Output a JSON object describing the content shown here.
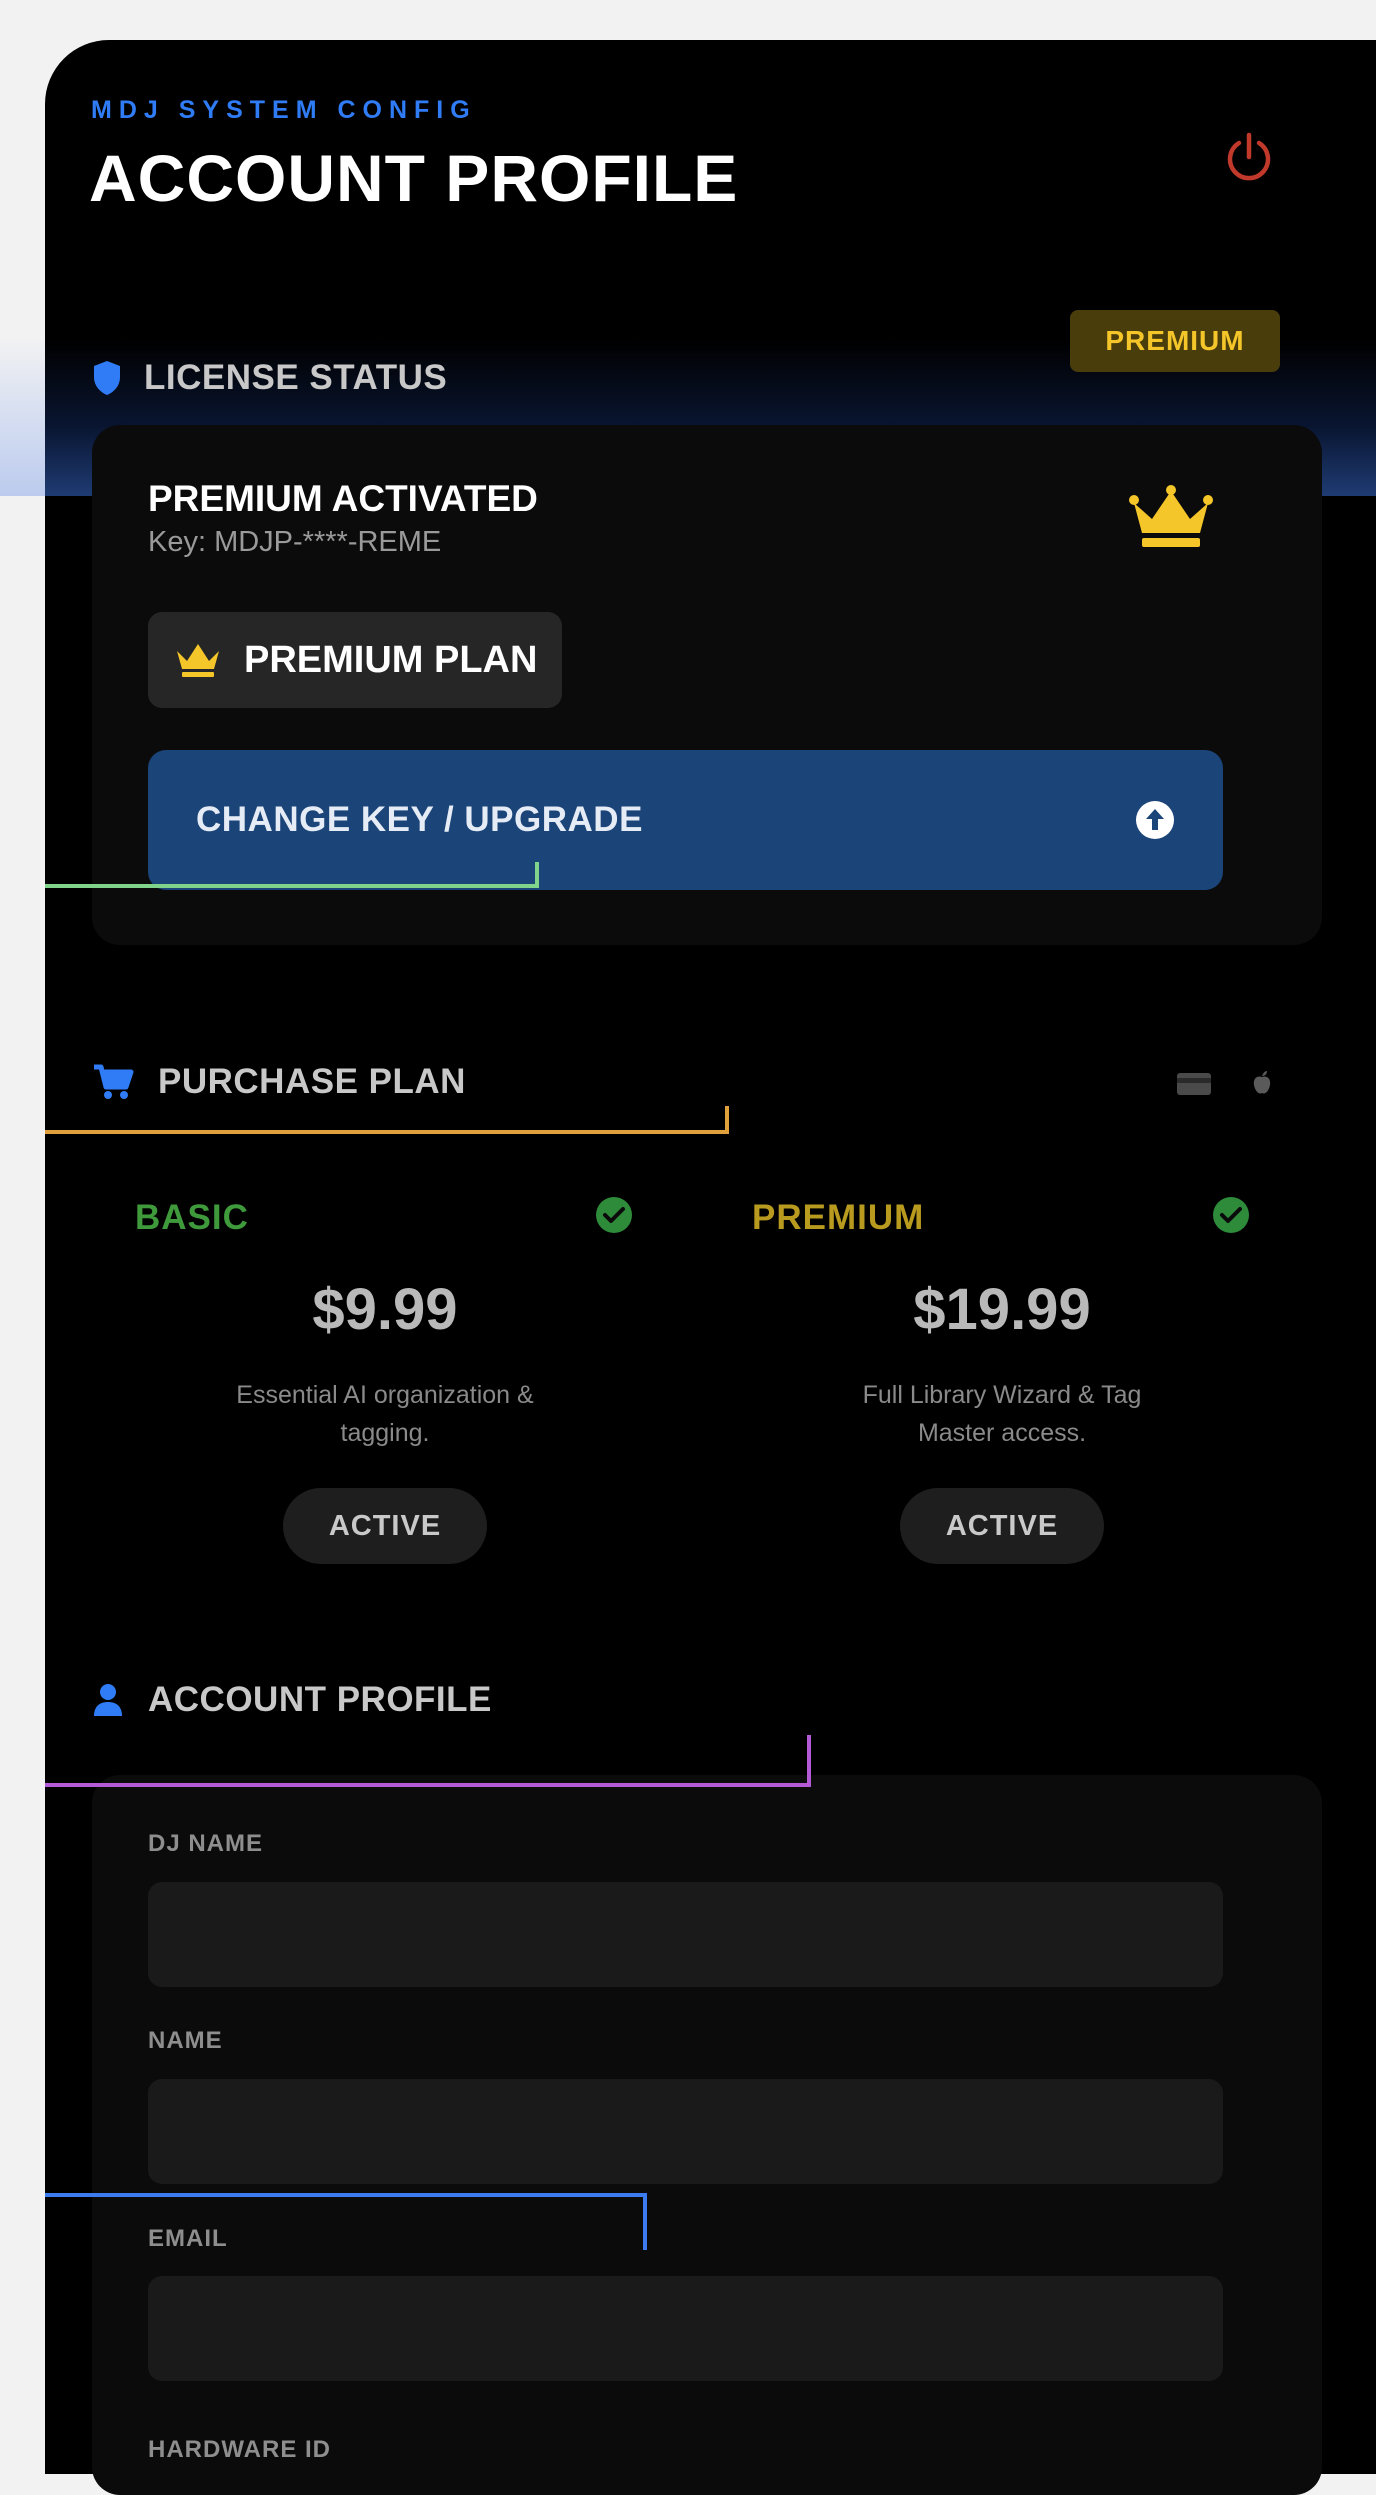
{
  "header": {
    "eyebrow": "MDJ SYSTEM CONFIG",
    "title": "ACCOUNT PROFILE",
    "power_icon": "power-icon"
  },
  "license": {
    "section_title": "LICENSE STATUS",
    "badge": "PREMIUM",
    "activated_title": "PREMIUM ACTIVATED",
    "key_text": "Key: MDJP-****-REME",
    "plan_chip": "PREMIUM PLAN",
    "upgrade_button": "CHANGE KEY / UPGRADE",
    "icons": [
      "shield-icon",
      "crown-icon",
      "arrow-up-circle-icon"
    ]
  },
  "purchase": {
    "section_title": "PURCHASE PLAN",
    "icons": [
      "cart-icon",
      "credit-card-icon",
      "apple-icon"
    ],
    "plans": [
      {
        "name": "BASIC",
        "price": "$9.99",
        "description": "Essential AI organization & tagging.",
        "status": "ACTIVE",
        "name_color": "#3f9a3c"
      },
      {
        "name": "PREMIUM",
        "price": "$19.99",
        "description": "Full Library Wizard & Tag Master access.",
        "status": "ACTIVE",
        "name_color": "#b89a1f"
      }
    ]
  },
  "profile": {
    "section_title": "ACCOUNT PROFILE",
    "fields": [
      {
        "label": "DJ NAME",
        "value": ""
      },
      {
        "label": "NAME",
        "value": ""
      },
      {
        "label": "EMAIL",
        "value": ""
      },
      {
        "label": "HARDWARE ID",
        "value": ""
      }
    ]
  },
  "colors": {
    "accent_blue": "#2f7cf6",
    "premium_gold": "#f5c629",
    "check_green": "#2e8b3a",
    "power_red": "#c0392b",
    "upgrade_button_bg": "#1b4479"
  }
}
